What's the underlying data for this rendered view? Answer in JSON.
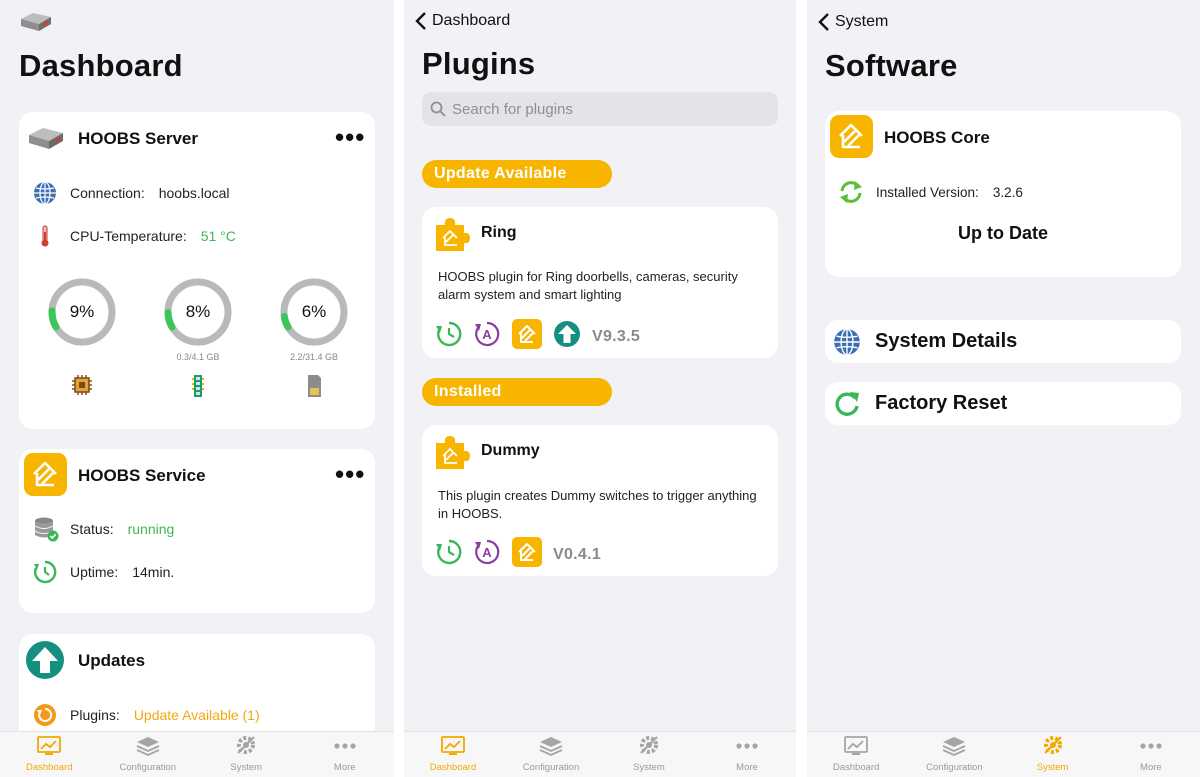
{
  "colors": {
    "accent": "#f7b500",
    "green": "#3bb75a",
    "background": "#f2f2f6",
    "card": "#ffffff"
  },
  "dashboard": {
    "title": "Dashboard",
    "server": {
      "title": "HOOBS Server",
      "more": "•••",
      "connection_label": "Connection:",
      "connection_value": "hoobs.local",
      "cpu_label": "CPU-Temperature:",
      "cpu_value": "51 °C",
      "gauges": [
        {
          "label": "9%",
          "percent": 9,
          "sub": "",
          "icon": "cpu-icon"
        },
        {
          "label": "8%",
          "percent": 8,
          "sub": "0.3/4.1 GB",
          "icon": "memory-icon"
        },
        {
          "label": "6%",
          "percent": 6,
          "sub": "2.2/31.4 GB",
          "icon": "sd-card-icon"
        }
      ]
    },
    "service": {
      "title": "HOOBS Service",
      "more": "•••",
      "status_label": "Status:",
      "status_value": "running",
      "uptime_label": "Uptime:",
      "uptime_value": "14min."
    },
    "updates": {
      "title": "Updates",
      "plugins_label": "Plugins:",
      "plugins_value": "Update Available (1)"
    }
  },
  "plugins": {
    "back": "Dashboard",
    "title": "Plugins",
    "search_placeholder": "Search for plugins",
    "section_update": "Update Available",
    "section_installed": "Installed",
    "items": [
      {
        "name": "Ring",
        "description": "HOOBS plugin for Ring doorbells, cameras, security  alarm system and smart lighting",
        "version": "V9.3.5"
      },
      {
        "name": "Dummy",
        "description": "This plugin creates Dummy switches to trigger anything in HOOBS.",
        "version": "V0.4.1"
      }
    ]
  },
  "software": {
    "back": "System",
    "title": "Software",
    "core": {
      "title": "HOOBS Core",
      "installed_label": "Installed Version:",
      "installed_value": "3.2.6",
      "status": "Up to Date"
    },
    "system_details": "System Details",
    "factory_reset": "Factory Reset"
  },
  "tabs": [
    {
      "label": "Dashboard",
      "icon": "dashboard-icon"
    },
    {
      "label": "Configuration",
      "icon": "configuration-icon"
    },
    {
      "label": "System",
      "icon": "system-icon"
    },
    {
      "label": "More",
      "icon": "more-icon"
    }
  ]
}
